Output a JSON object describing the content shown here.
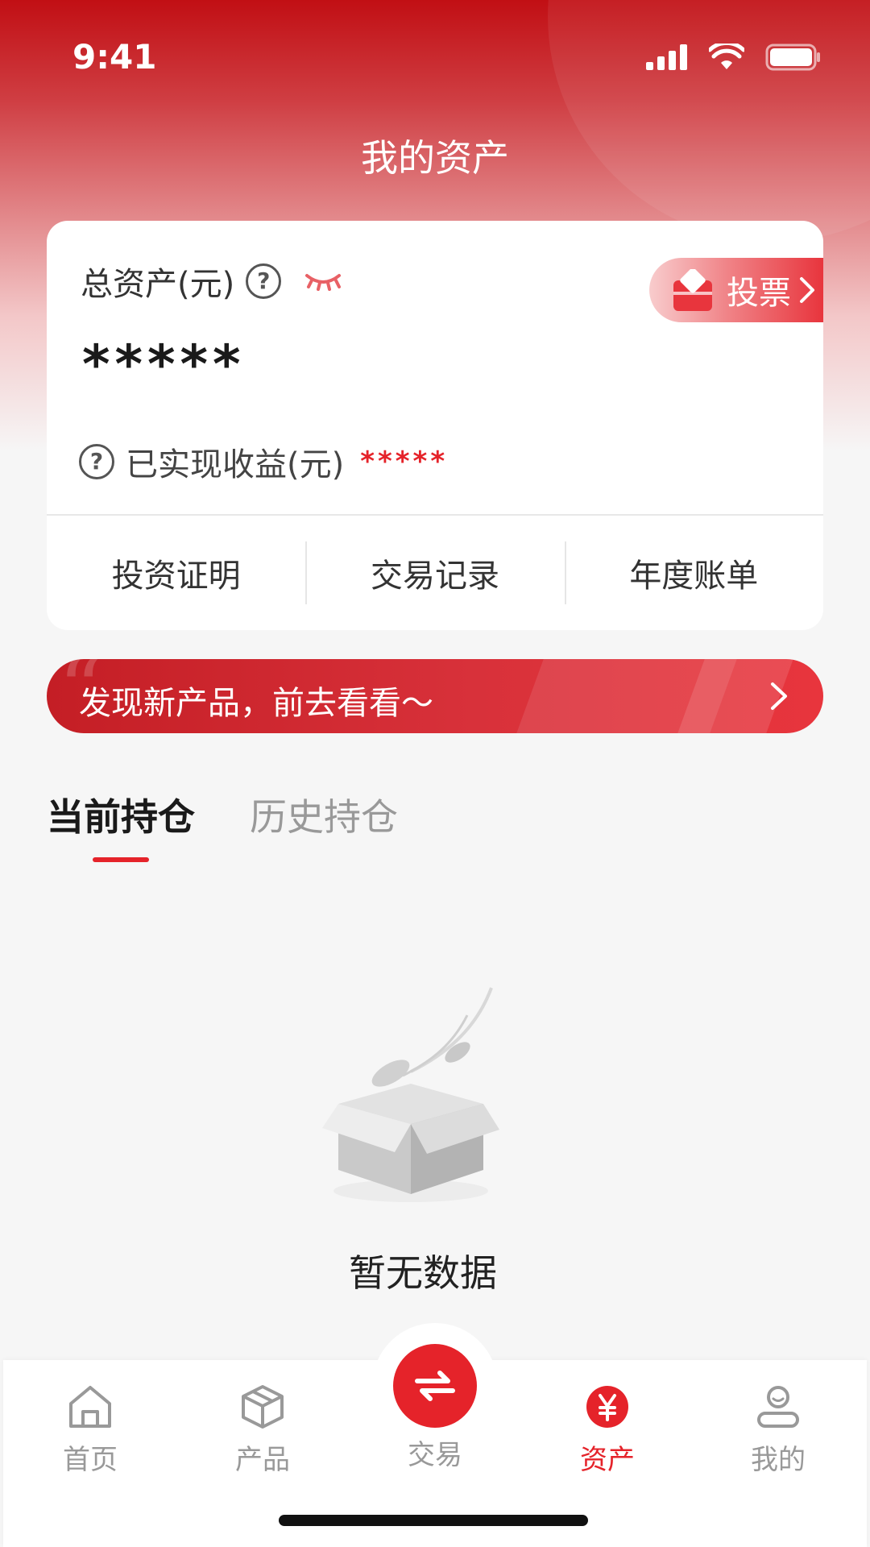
{
  "status_bar": {
    "time": "9:41"
  },
  "page": {
    "title": "我的资产"
  },
  "asset_card": {
    "total_label": "总资产(元)",
    "help_symbol": "?",
    "total_value": "*****",
    "realized_label": "已实现收益(元)",
    "realized_value": "*****",
    "vote_label": "投票",
    "actions": [
      "投资证明",
      "交易记录",
      "年度账单"
    ]
  },
  "promo": {
    "text": "发现新产品，前去看看～"
  },
  "tabs": {
    "current": "当前持仓",
    "history": "历史持仓"
  },
  "empty": {
    "text": "暂无数据"
  },
  "nav": {
    "items": [
      {
        "label": "首页",
        "icon": "home-icon"
      },
      {
        "label": "产品",
        "icon": "box-icon"
      },
      {
        "label": "交易",
        "icon": "exchange-icon"
      },
      {
        "label": "资产",
        "icon": "yuan-icon",
        "active": true
      },
      {
        "label": "我的",
        "icon": "user-icon"
      }
    ]
  },
  "colors": {
    "brand_red": "#e5232a",
    "header_red": "#c10f14",
    "muted": "#999999"
  }
}
